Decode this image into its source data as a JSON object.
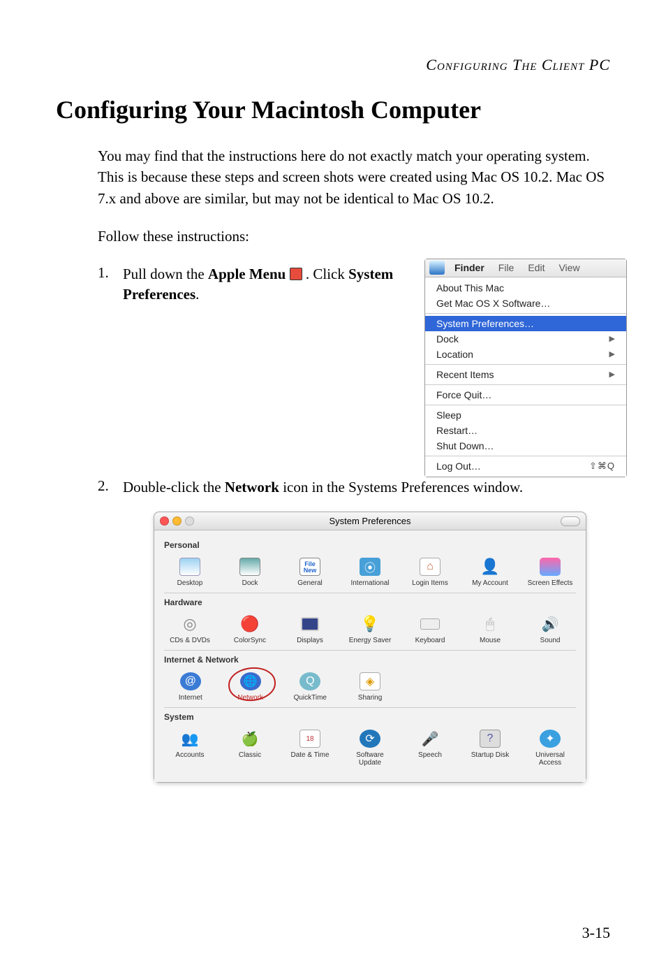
{
  "header": {
    "running": "Configuring The Client PC"
  },
  "title": "Configuring Your Macintosh Computer",
  "intro": "You may find that the instructions here do not exactly match your operating system. This is because these steps and screen shots were created using Mac OS 10.2. Mac OS 7.x and above are similar, but may not be identical to Mac OS 10.2.",
  "follow": "Follow these instructions:",
  "steps": {
    "one_num": "1.",
    "one_a": "Pull down the ",
    "one_b": "Apple Menu",
    "one_c": " . Click ",
    "one_d": "System Preferences",
    "one_e": ".",
    "two_num": "2.",
    "two_a": "Double-click the ",
    "two_b": "Network",
    "two_c": " icon in the Systems Preferences window."
  },
  "apple_menu": {
    "menubar": {
      "finder": "Finder",
      "file": "File",
      "edit": "Edit",
      "view": "View"
    },
    "about": "About This Mac",
    "getsw": "Get Mac OS X Software…",
    "syspref": "System Preferences…",
    "dock": "Dock",
    "location": "Location",
    "recent": "Recent Items",
    "forcequit": "Force Quit…",
    "sleep": "Sleep",
    "restart": "Restart…",
    "shutdown": "Shut Down…",
    "logout": "Log Out…",
    "logout_shortcut": "⇧⌘Q"
  },
  "syspref": {
    "title": "System Preferences",
    "personal": "Personal",
    "hardware": "Hardware",
    "internet": "Internet & Network",
    "system": "System",
    "items": {
      "desktop": "Desktop",
      "dock": "Dock",
      "general": "General",
      "intl": "International",
      "login": "Login Items",
      "myacct": "My Account",
      "screenfx": "Screen Effects",
      "cds": "CDs & DVDs",
      "colorsync": "ColorSync",
      "displays": "Displays",
      "energy": "Energy Saver",
      "keyboard": "Keyboard",
      "mouse": "Mouse",
      "sound": "Sound",
      "internet": "Internet",
      "network": "Network",
      "quicktime": "QuickTime",
      "sharing": "Sharing",
      "accounts": "Accounts",
      "classic": "Classic",
      "date": "Date & Time",
      "software": "Software Update",
      "speech": "Speech",
      "startup": "Startup Disk",
      "universal": "Universal Access"
    }
  },
  "page_number": "3-15"
}
